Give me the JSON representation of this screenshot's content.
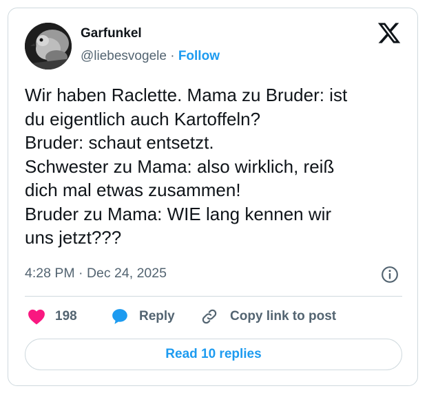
{
  "author": {
    "name": "Garfunkel",
    "handle": "@liebesvogele",
    "separator": " · ",
    "follow_label": "Follow"
  },
  "post": {
    "lines": [
      "Wir haben Raclette. Mama zu Bruder: ist",
      "du eigentlich auch Kartoffeln?",
      "Bruder: schaut entsetzt.",
      "Schwester zu Mama: also wirklich, reiß",
      "dich mal etwas zusammen!",
      "Bruder zu Mama: WIE lang kennen wir",
      "uns jetzt???"
    ],
    "timestamp": "4:28 PM · Dec 24, 2025"
  },
  "actions": {
    "like_count": "198",
    "reply_label": "Reply",
    "copy_label": "Copy link to post"
  },
  "read_replies_label": "Read 10 replies",
  "colors": {
    "accent": "#1d9bf0",
    "like": "#f91880",
    "muted": "#536471",
    "border": "#cfd9de"
  }
}
